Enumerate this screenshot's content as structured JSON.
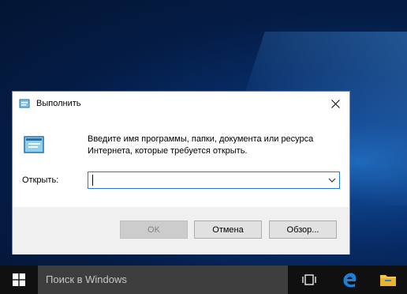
{
  "dialog": {
    "title": "Выполнить",
    "description": "Введите имя программы, папки, документа или ресурса Интернета, которые требуется открыть.",
    "open_label": "Открыть:",
    "open_value": "",
    "buttons": {
      "ok": "OK",
      "cancel": "Отмена",
      "browse": "Обзор..."
    }
  },
  "taskbar": {
    "search_placeholder": "Поиск в Windows",
    "icons": [
      "windows-start-icon",
      "task-view-icon",
      "edge-icon",
      "file-explorer-icon"
    ]
  },
  "colors": {
    "accent": "#2b78d4",
    "taskbar": "#101010",
    "search_box": "#3e3e3e",
    "edge_blue": "#1c7fd8",
    "folder_yellow": "#f5c543"
  }
}
